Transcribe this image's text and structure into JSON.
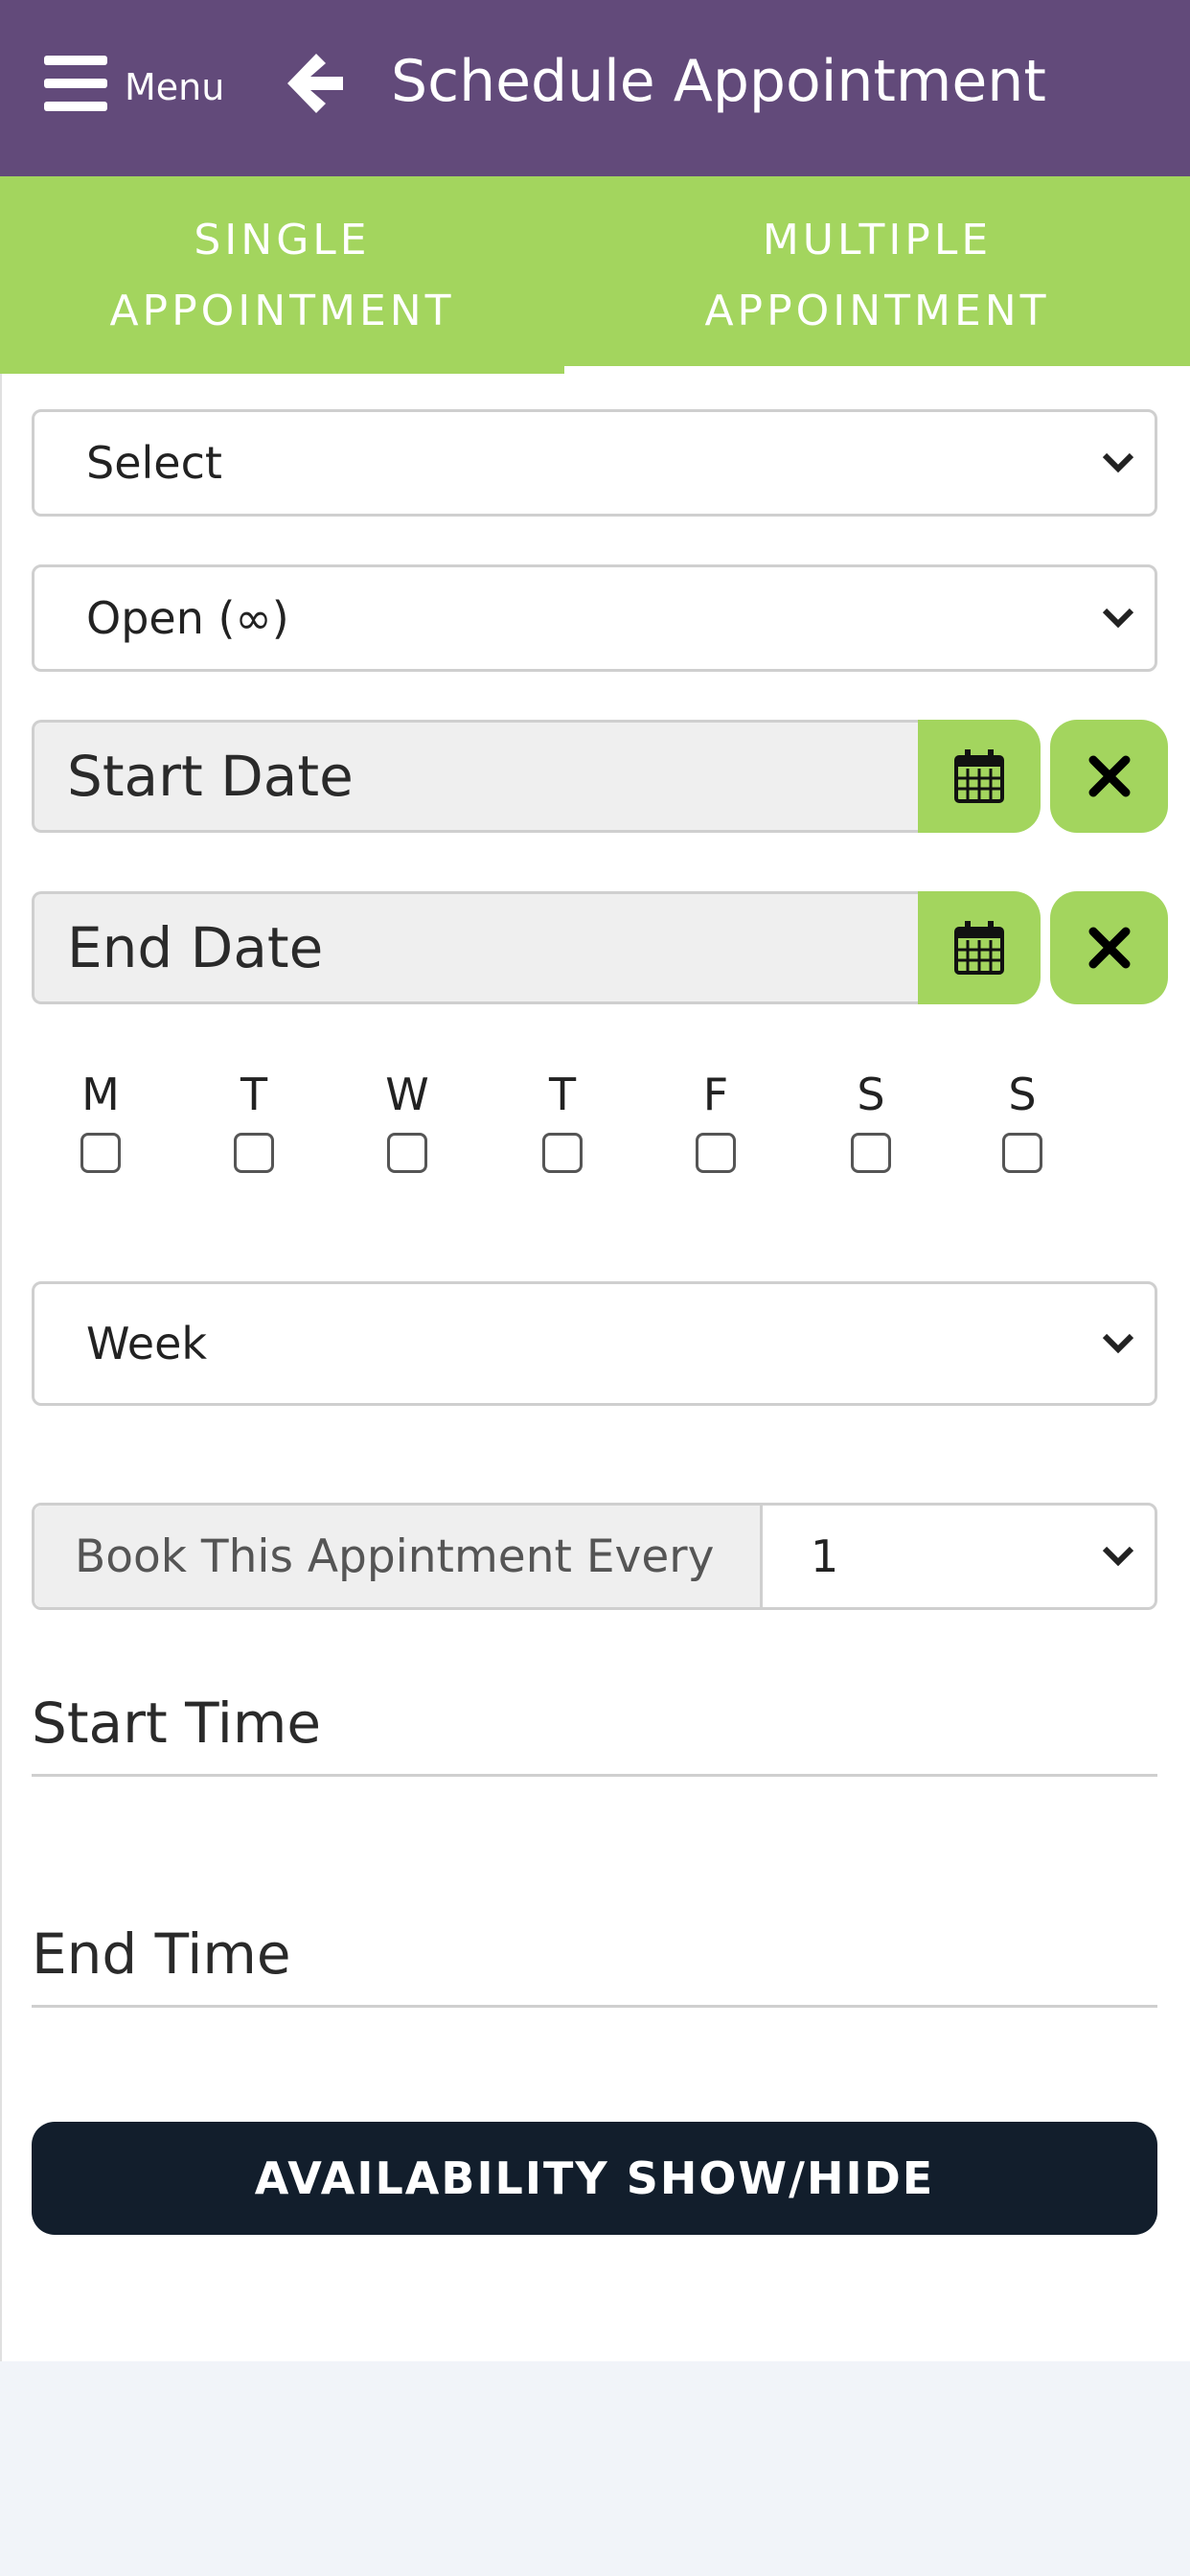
{
  "header": {
    "menu_label": "Menu",
    "title": "Schedule Appointment"
  },
  "tabs": [
    {
      "label_line1": "SINGLE",
      "label_line2": "APPOINTMENT",
      "active": false
    },
    {
      "label_line1": "MULTIPLE",
      "label_line2": "APPOINTMENT",
      "active": true
    }
  ],
  "form": {
    "select_1": "Select",
    "select_2": "Open (∞)",
    "start_date_placeholder": "Start Date",
    "end_date_placeholder": "End Date",
    "days": [
      "M",
      "T",
      "W",
      "T",
      "F",
      "S",
      "S"
    ],
    "recurrence_unit": "Week",
    "book_every_label": "Book This Appintment Every",
    "book_every_value": "1",
    "start_time_placeholder": "Start Time",
    "end_time_placeholder": "End Time",
    "availability_button": "AVAILABILITY SHOW/HIDE"
  },
  "icons": {
    "menu": "hamburger-icon",
    "back": "arrow-left-icon",
    "calendar": "calendar-icon",
    "clear": "close-icon",
    "dropdown": "chevron-down-icon"
  },
  "colors": {
    "header": "#624a7a",
    "accent_green": "#a3d55e",
    "button_dark": "#121e2c"
  }
}
